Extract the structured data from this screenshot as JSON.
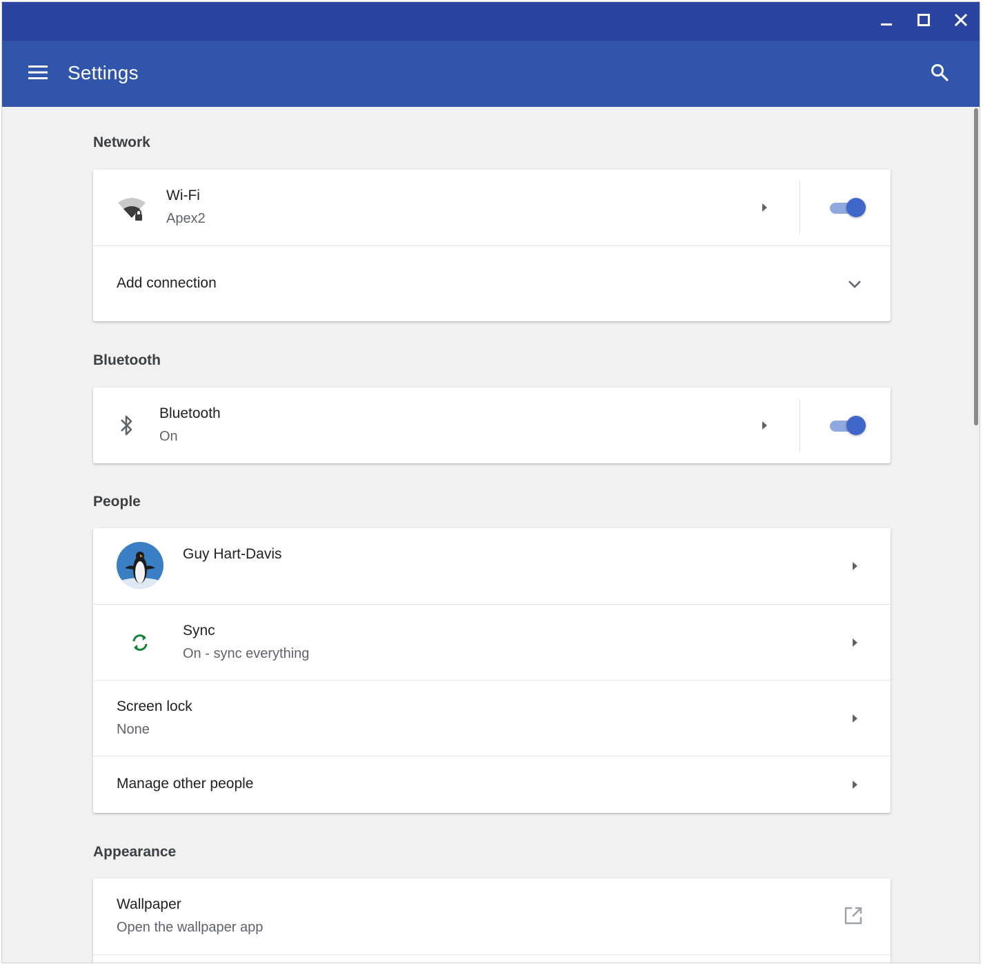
{
  "window": {
    "controls": [
      "minimize-icon",
      "maximize-icon",
      "close-icon"
    ]
  },
  "appbar": {
    "title": "Settings",
    "menu_icon": "hamburger-menu-icon",
    "search_icon": "search-icon",
    "color": "#3055aa"
  },
  "sections": {
    "network": {
      "title": "Network",
      "wifi": {
        "label": "Wi-Fi",
        "value": "Apex2",
        "icon": "wifi-lock-icon",
        "enabled": true
      },
      "add_connection": {
        "label": "Add connection",
        "icon": "chevron-down-icon"
      }
    },
    "bluetooth": {
      "title": "Bluetooth",
      "item": {
        "label": "Bluetooth",
        "value": "On",
        "icon": "bluetooth-icon",
        "enabled": true
      }
    },
    "people": {
      "title": "People",
      "account": {
        "label": "Guy Hart-Davis",
        "icon": "penguin-avatar"
      },
      "sync": {
        "label": "Sync",
        "value": "On - sync everything",
        "icon": "sync-icon",
        "color": "#188038"
      },
      "screen_lock": {
        "label": "Screen lock",
        "value": "None"
      },
      "manage": {
        "label": "Manage other people"
      }
    },
    "appearance": {
      "title": "Appearance",
      "wallpaper": {
        "label": "Wallpaper",
        "value": "Open the wallpaper app",
        "icon": "open-external-icon"
      }
    }
  },
  "colors": {
    "titlebar": "#2a44a0",
    "toggle_on": "#3f67c9",
    "background": "#f1f1f1"
  }
}
